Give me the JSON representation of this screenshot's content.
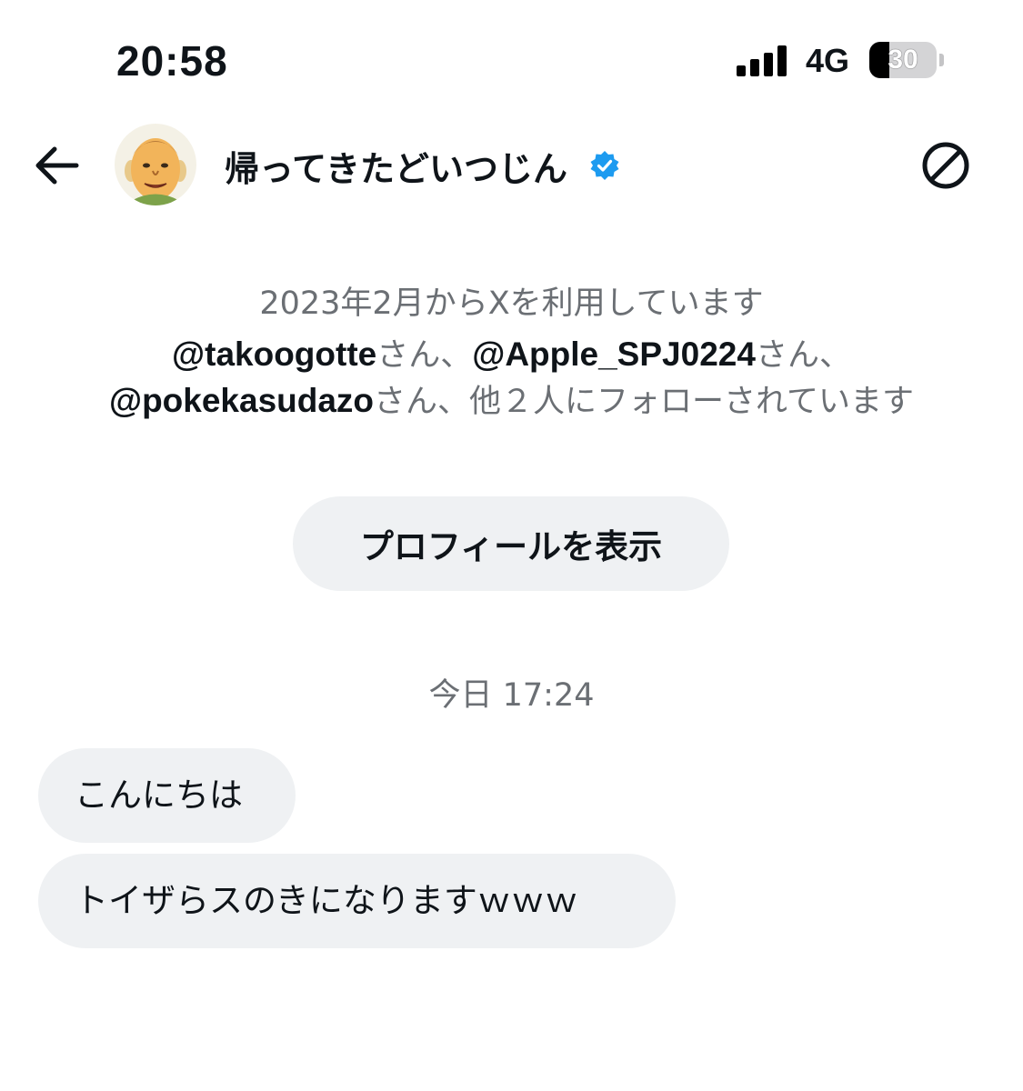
{
  "status_bar": {
    "time": "20:58",
    "network": "4G",
    "battery_label": "30",
    "battery_level_percent": 30
  },
  "header": {
    "name": "帰ってきたどいつじん",
    "verified": true,
    "verified_color": "#1d9bf0"
  },
  "profile_info": {
    "joined": "2023年2月からXを利用しています",
    "followed_by": {
      "handle_1": "@takoogotte",
      "suffix_1": "さん、",
      "handle_2": "@Apple_SPJ0224",
      "suffix_2": "さん、",
      "handle_3": "@pokekasudazo",
      "suffix_3": "さん、他２人にフォローされています"
    },
    "view_profile_label": "プロフィールを表示"
  },
  "conversation": {
    "timestamp": "今日 17:24",
    "messages": [
      {
        "text": "こんにちは"
      },
      {
        "text": "トイザらスのきになりますｗｗｗ"
      }
    ]
  },
  "colors": {
    "bubble_background": "#eff1f3",
    "secondary_text": "#6b6f74",
    "primary_text": "#0f1419"
  }
}
